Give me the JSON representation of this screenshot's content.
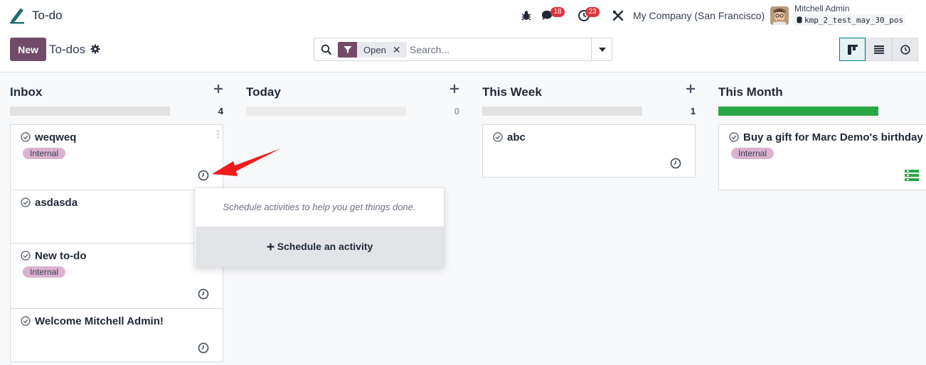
{
  "app": {
    "name": "To-do",
    "accent_color": "#714b67"
  },
  "systray": {
    "bug_icon": "bug-icon",
    "messages_icon": "chat-icon",
    "messages_count": "18",
    "activities_icon": "clock-icon",
    "activities_count": "23",
    "tools_icon": "tools-icon",
    "company": "My Company (San Francisco)",
    "user_name": "Mitchell Admin",
    "database": "kmp_2_test_may_30_pos"
  },
  "control_panel": {
    "new_label": "New",
    "breadcrumb": "To-dos",
    "search": {
      "facet": "Open",
      "placeholder": "Search..."
    }
  },
  "columns": [
    {
      "title": "Inbox",
      "count": "4",
      "cards": [
        {
          "title": "weqweq",
          "tag": "Internal"
        },
        {
          "title": "asdasda"
        },
        {
          "title": "New to-do",
          "tag": "Internal"
        },
        {
          "title": "Welcome Mitchell Admin!"
        }
      ]
    },
    {
      "title": "Today",
      "count": "0",
      "cards": []
    },
    {
      "title": "This Week",
      "count": "1",
      "cards": [
        {
          "title": "abc"
        }
      ]
    },
    {
      "title": "This Month",
      "cards": [
        {
          "title": "Buy a gift for Marc Demo's birthday",
          "tag": "Internal"
        }
      ]
    }
  ],
  "popover": {
    "message": "Schedule activities to help you get things done.",
    "button_label": "Schedule an activity"
  },
  "colors": {
    "progress_green": "#28a745",
    "badge_red": "#d9363e",
    "tag_pink": "#dcb2cf",
    "annotation_arrow": "#ee1c1c"
  }
}
